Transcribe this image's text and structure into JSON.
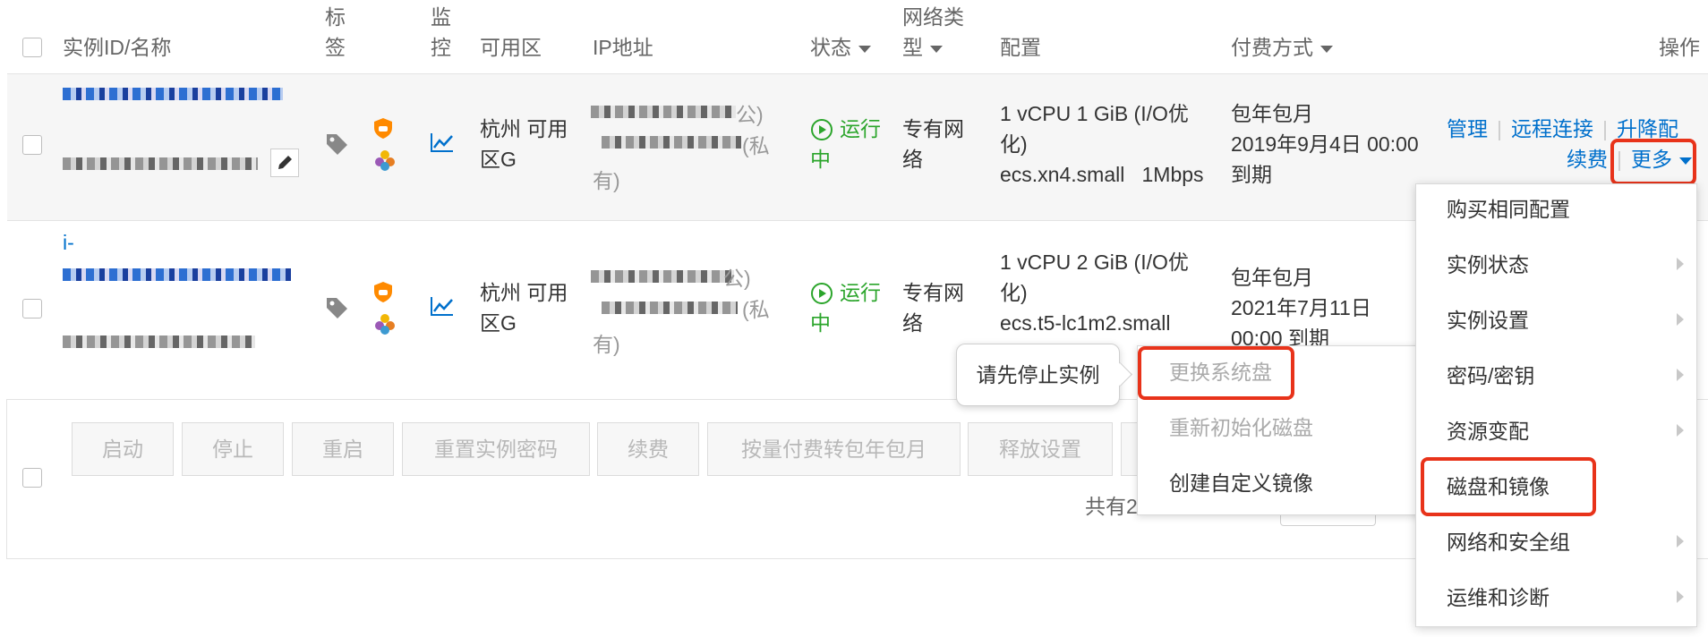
{
  "header": {
    "instance_id_name": "实例ID/名称",
    "tag": "标签",
    "tag_l1": "标",
    "tag_l2": "签",
    "monitor_l1": "监",
    "monitor_l2": "控",
    "zone": "可用区",
    "ip": "IP地址",
    "status": "状态",
    "network_l1": "网络类",
    "network_l2": "型",
    "config": "配置",
    "billing": "付费方式",
    "actions": "操作"
  },
  "rows": [
    {
      "zone_l1": "杭州 可用",
      "zone_l2": "区G",
      "ip_public_suffix": "公)",
      "ip_private_suffix": "(私",
      "ip_private_l2": "有)",
      "status_l1": "运行",
      "status_l2": "中",
      "network_l1": "专有网",
      "network_l2": "络",
      "config_l1": "1 vCPU 1 GiB (I/O优",
      "config_l2": "化)",
      "config_l3": "ecs.xn4.small   1Mbps",
      "billing_l1": "包年包月",
      "billing_l2": "2019年9月4日 00:00",
      "billing_l3": "到期",
      "action_manage": "管理",
      "action_remote": "远程连接",
      "action_upgrade": "升降配",
      "action_renew": "续费",
      "action_more": "更多"
    },
    {
      "id_prefix": "i-",
      "zone_l1": "杭州 可用",
      "zone_l2": "区G",
      "ip_public_suffix": "公)",
      "ip_private_suffix": "(私",
      "ip_private_l2": "有)",
      "status_l1": "运行",
      "status_l2": "中",
      "network_l1": "专有网",
      "network_l2": "络",
      "config_l1": "1 vCPU 2 GiB (I/O优",
      "config_l2": "化)",
      "config_l3": "ecs.t5-lc1m2.small",
      "billing_l1": "包年包月",
      "billing_l2": "2021年7月11日",
      "billing_l3": "00:00 到期"
    }
  ],
  "batch_buttons": [
    "启动",
    "停止",
    "重启",
    "重置实例密码",
    "续费",
    "按量付费转包年包月",
    "释放设置"
  ],
  "footer_total": "共有2",
  "more_menu": [
    {
      "label": "购买相同配置",
      "has_submenu": false
    },
    {
      "label": "实例状态",
      "has_submenu": true
    },
    {
      "label": "实例设置",
      "has_submenu": true
    },
    {
      "label": "密码/密钥",
      "has_submenu": true
    },
    {
      "label": "资源变配",
      "has_submenu": true
    },
    {
      "label": "磁盘和镜像",
      "has_submenu": false
    },
    {
      "label": "网络和安全组",
      "has_submenu": true
    },
    {
      "label": "运维和诊断",
      "has_submenu": true
    }
  ],
  "disk_submenu": [
    {
      "label": "更换系统盘",
      "disabled": true
    },
    {
      "label": "重新初始化磁盘",
      "disabled": true
    },
    {
      "label": "创建自定义镜像",
      "disabled": false
    }
  ],
  "tooltip": "请先停止实例",
  "colors": {
    "link": "#0070cc",
    "running": "#2ba52b",
    "highlight": "#e8331a",
    "row_bg": "#f6f6f6"
  }
}
